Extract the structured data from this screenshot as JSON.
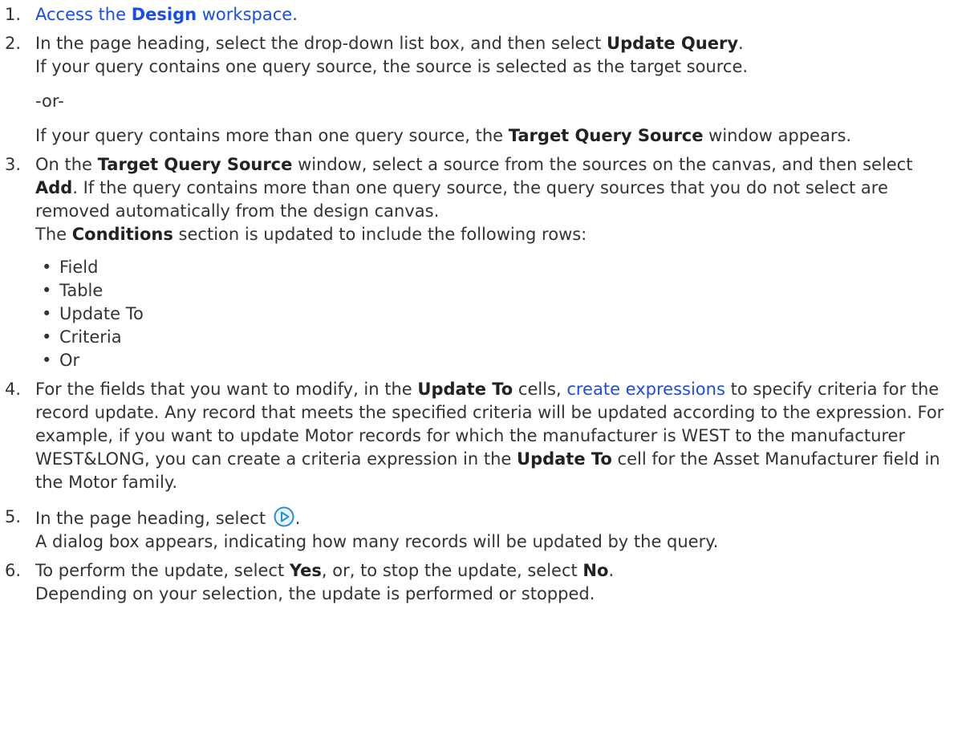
{
  "steps": [
    {
      "number": "1",
      "link_a": "Access the ",
      "link_bold": "Design",
      "link_b": " workspace",
      "end": "."
    },
    {
      "number": "2",
      "p1_a": "In the page heading, select the drop-down list box, and then select ",
      "p1_bold": "Update Query",
      "p1_b": ".",
      "p2": "If your query contains one query source, the source is selected as the target source.",
      "or": "-or-",
      "p3_a": "If your query contains more than one query source, the ",
      "p3_bold": "Target Query Source",
      "p3_b": " window appears."
    },
    {
      "number": "3",
      "p1_a": "On the ",
      "p1_bold1": "Target Query Source",
      "p1_b": " window, select a source from the sources on the canvas, and then select ",
      "p1_bold2": "Add",
      "p1_c": ". If the query contains more than one query source, the query sources that you do not select are removed automatically from the design canvas.",
      "p2_a": "The ",
      "p2_bold": "Conditions",
      "p2_b": " section is updated to include the following rows:",
      "rows": [
        "Field",
        "Table",
        "Update To",
        "Criteria",
        "Or"
      ]
    },
    {
      "number": "4",
      "p1_a": "For the fields that you want to modify, in the ",
      "p1_bold1": "Update To",
      "p1_b": " cells, ",
      "p1_link": "create expressions",
      "p1_c": " to specify criteria for the record update. Any record that meets the specified criteria will be updated according to the expression. For example, if you want to update Motor records for which the manufacturer is WEST to the manufacturer WEST&LONG, you can create a criteria expression in the ",
      "p1_bold2": "Update To",
      "p1_d": " cell for the Asset Manufacturer field in the Motor family."
    },
    {
      "number": "5",
      "p1_a": "In the page heading, select ",
      "p1_b": ".",
      "p2": "A dialog box appears, indicating how many records will be updated by the query.",
      "icon": "run-query-icon"
    },
    {
      "number": "6",
      "p1_a": "To perform the update, select ",
      "p1_bold1": "Yes",
      "p1_b": ", or, to stop the update, select ",
      "p1_bold2": "No",
      "p1_c": ".",
      "p2": "Depending on your selection, the update is performed or stopped."
    }
  ],
  "colors": {
    "text": "#333333",
    "link": "#1a4ce6",
    "icon": "#2a8fd6"
  }
}
